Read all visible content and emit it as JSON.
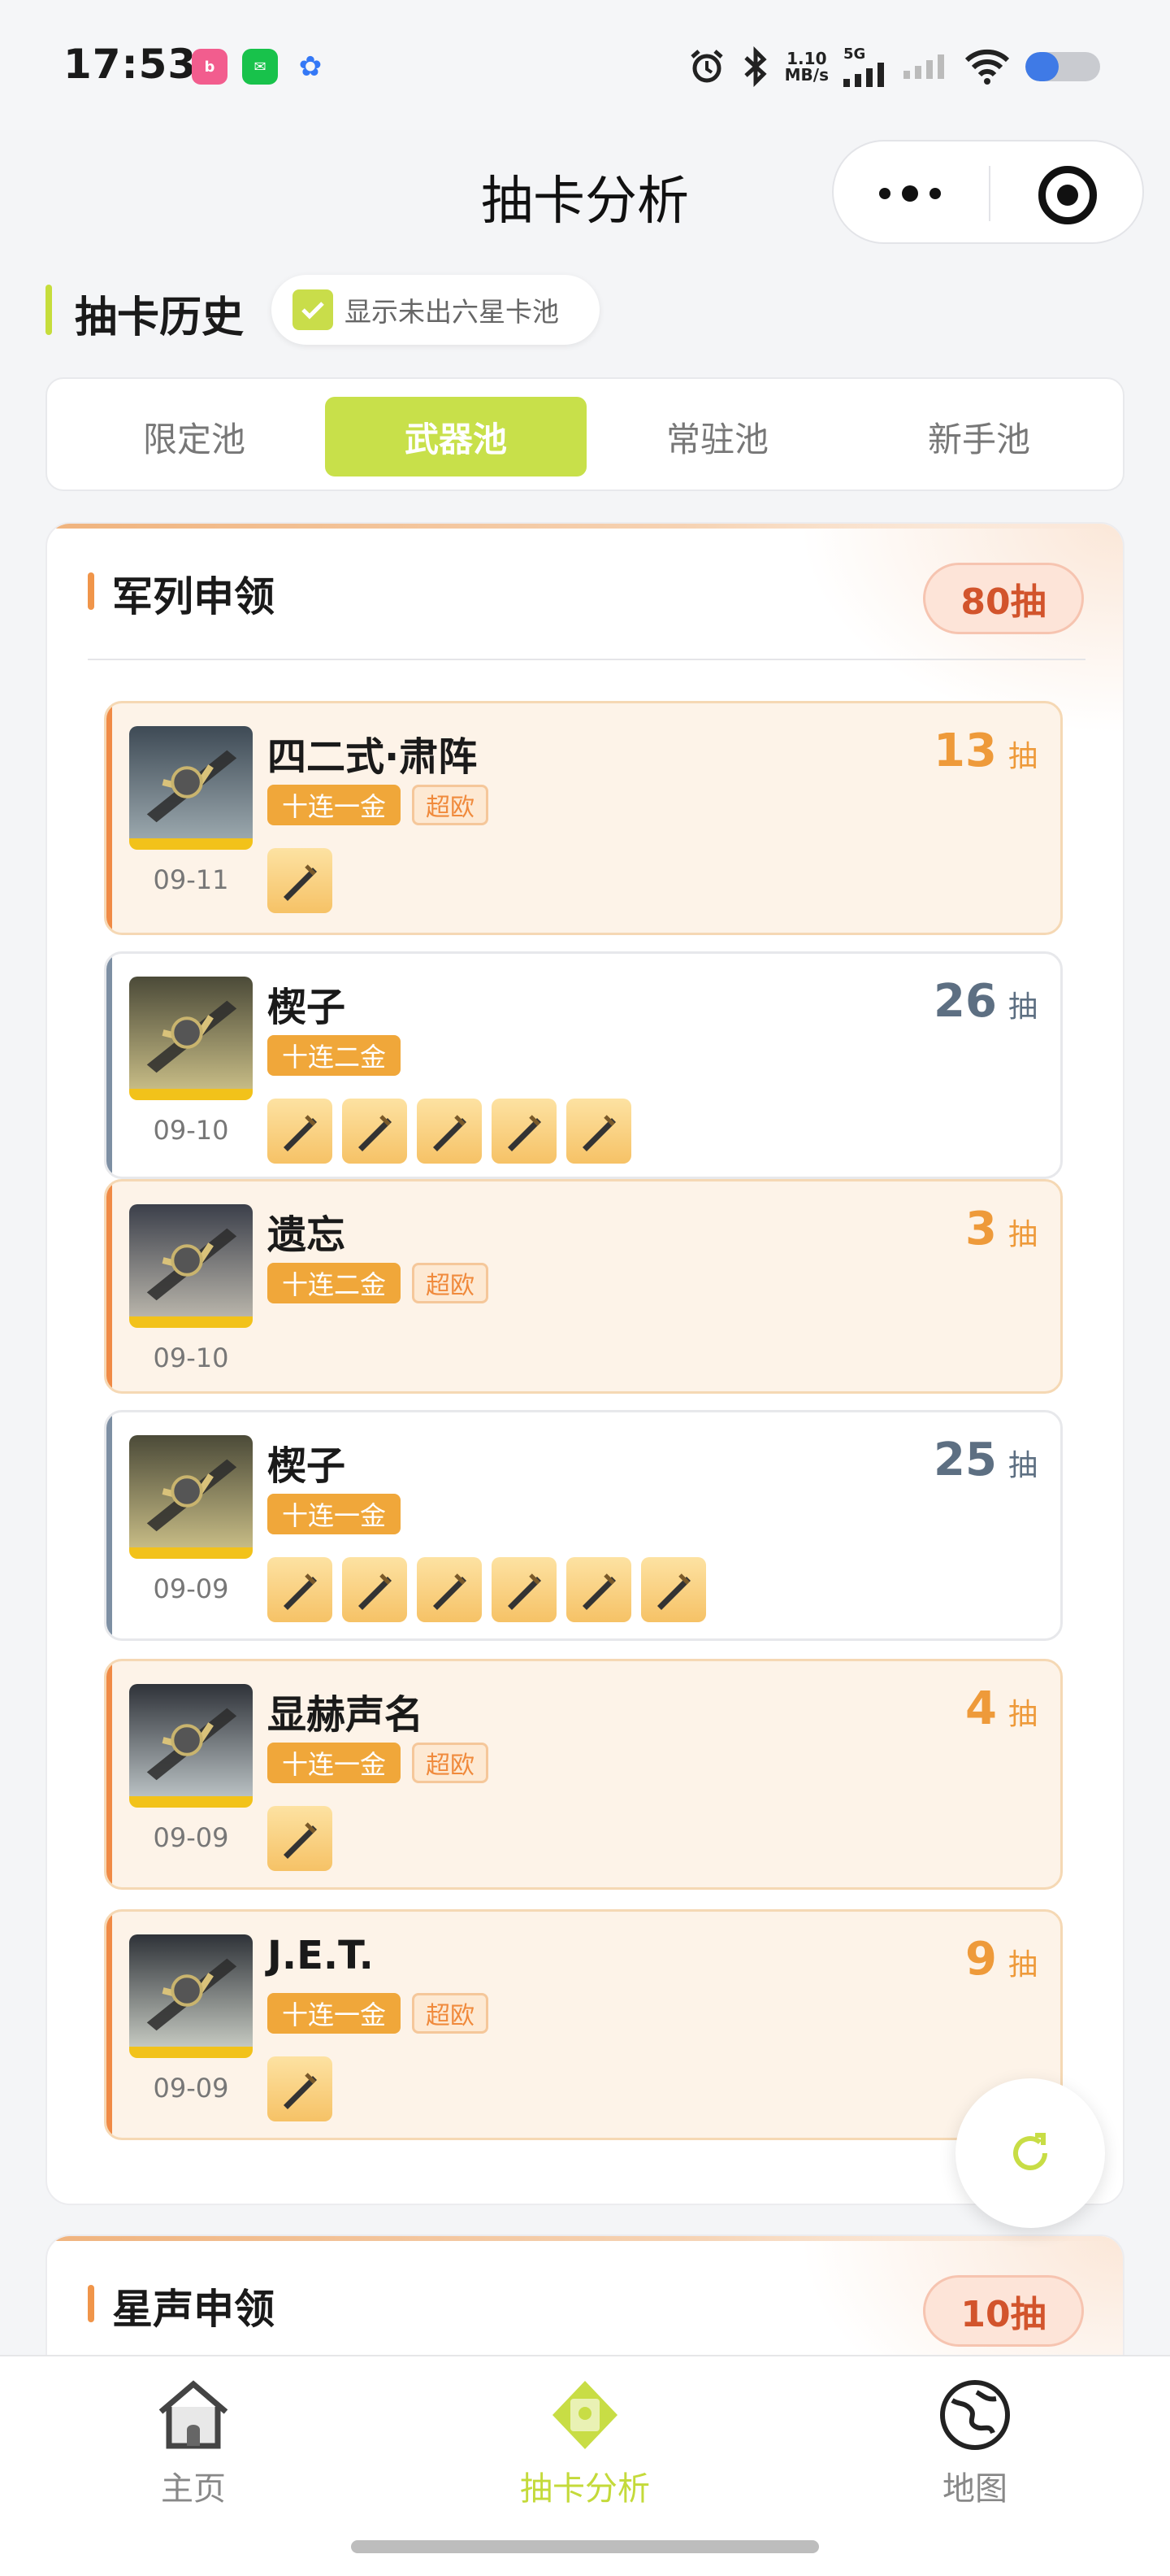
{
  "status_bar": {
    "time": "17:53",
    "net_speed_value": "1.10",
    "net_speed_unit": "MB/s",
    "signal_label": "5G",
    "battery_level": 0.45
  },
  "header": {
    "title": "抽卡分析"
  },
  "history": {
    "title": "抽卡历史",
    "toggle_label": "显示未出六星卡池",
    "toggle_checked": true
  },
  "tabs": [
    {
      "label": "限定池",
      "active": false
    },
    {
      "label": "武器池",
      "active": true
    },
    {
      "label": "常驻池",
      "active": false
    },
    {
      "label": "新手池",
      "active": false
    }
  ],
  "pools": [
    {
      "title": "军列申领",
      "total": "80抽",
      "entries": [
        {
          "name": "四二式·肃阵",
          "date": "09-11",
          "tag": "十连一金",
          "lucky": "超欧",
          "count": "13",
          "unit": "抽",
          "style": "gold",
          "icon_count": 1
        },
        {
          "name": "楔子",
          "date": "09-10",
          "tag": "十连二金",
          "lucky": "",
          "count": "26",
          "unit": "抽",
          "style": "plain",
          "icon_count": 5
        },
        {
          "name": "遗忘",
          "date": "09-10",
          "tag": "十连二金",
          "lucky": "超欧",
          "count": "3",
          "unit": "抽",
          "style": "gold",
          "icon_count": 0
        },
        {
          "name": "楔子",
          "date": "09-09",
          "tag": "十连一金",
          "lucky": "",
          "count": "25",
          "unit": "抽",
          "style": "plain",
          "icon_count": 6
        },
        {
          "name": "显赫声名",
          "date": "09-09",
          "tag": "十连一金",
          "lucky": "超欧",
          "count": "4",
          "unit": "抽",
          "style": "gold",
          "icon_count": 1
        },
        {
          "name": "J.E.T.",
          "date": "09-09",
          "tag": "十连一金",
          "lucky": "超欧",
          "count": "9",
          "unit": "抽",
          "style": "gold",
          "icon_count": 1
        }
      ]
    },
    {
      "title": "星声申领",
      "total": "10抽"
    }
  ],
  "bottom_nav": [
    {
      "label": "主页",
      "icon": "home-icon",
      "active": false
    },
    {
      "label": "抽卡分析",
      "icon": "card-analysis-icon",
      "active": true
    },
    {
      "label": "地图",
      "icon": "map-icon",
      "active": false
    }
  ],
  "colors": {
    "accent_green": "#c8e04a",
    "gold_count": "#ee9a3a",
    "plain_count": "#5d6f82",
    "total_pill_text": "#d2542c"
  }
}
